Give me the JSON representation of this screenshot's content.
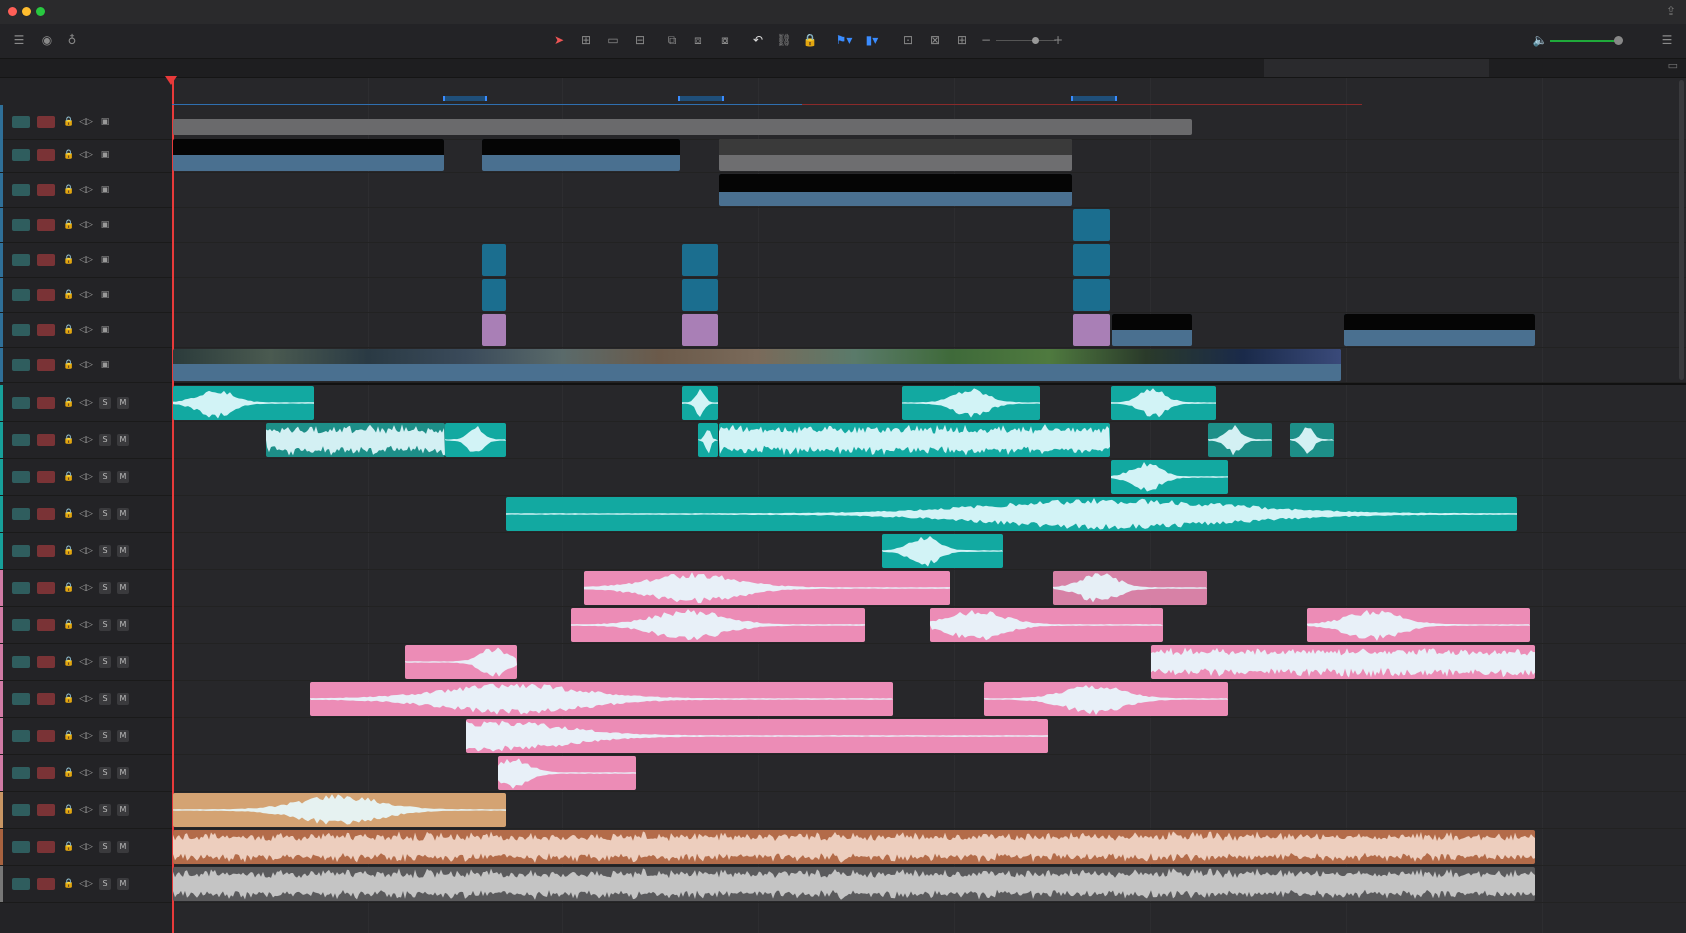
{
  "window": {
    "traffic_lights": [
      "#ff5f57",
      "#febc2e",
      "#28c840"
    ]
  },
  "icons": {
    "toolbar_left": [
      "timeline-view-options-icon",
      "eye-icon",
      "microphone-icon"
    ],
    "toolbar_center": [
      "selection-arrow-icon",
      "trim-edit-icon",
      "blade-icon",
      "dynamic-trim-icon",
      "insert-clip-icon",
      "overwrite-clip-icon",
      "replace-clip-icon",
      "snapping-icon",
      "linked-selection-icon",
      "position-lock-icon",
      "flag-icon",
      "marker-icon",
      "zoom-full-icon",
      "zoom-detail-icon",
      "zoom-custom-icon"
    ],
    "toolbar_right": [
      "speaker-icon",
      "mixer-options-icon"
    ],
    "track_header": [
      "lock-icon",
      "auto-select-icon",
      "toggle-track-icon"
    ]
  },
  "colors": {
    "video_blue": "#4a7090",
    "clip_black": "#050505",
    "adjust_teal": "#1b6e8f",
    "title_purple": "#a97fb6",
    "audio_teal": "#12a9a1",
    "audio_pink": "#ec8cb6",
    "audio_tan": "#d4a373",
    "audio_brown": "#b36b49",
    "audio_gray": "#5a5a5c",
    "playhead": "#e83a3a"
  },
  "track_header_badges": {
    "solo": "S",
    "mute": "M"
  }
}
